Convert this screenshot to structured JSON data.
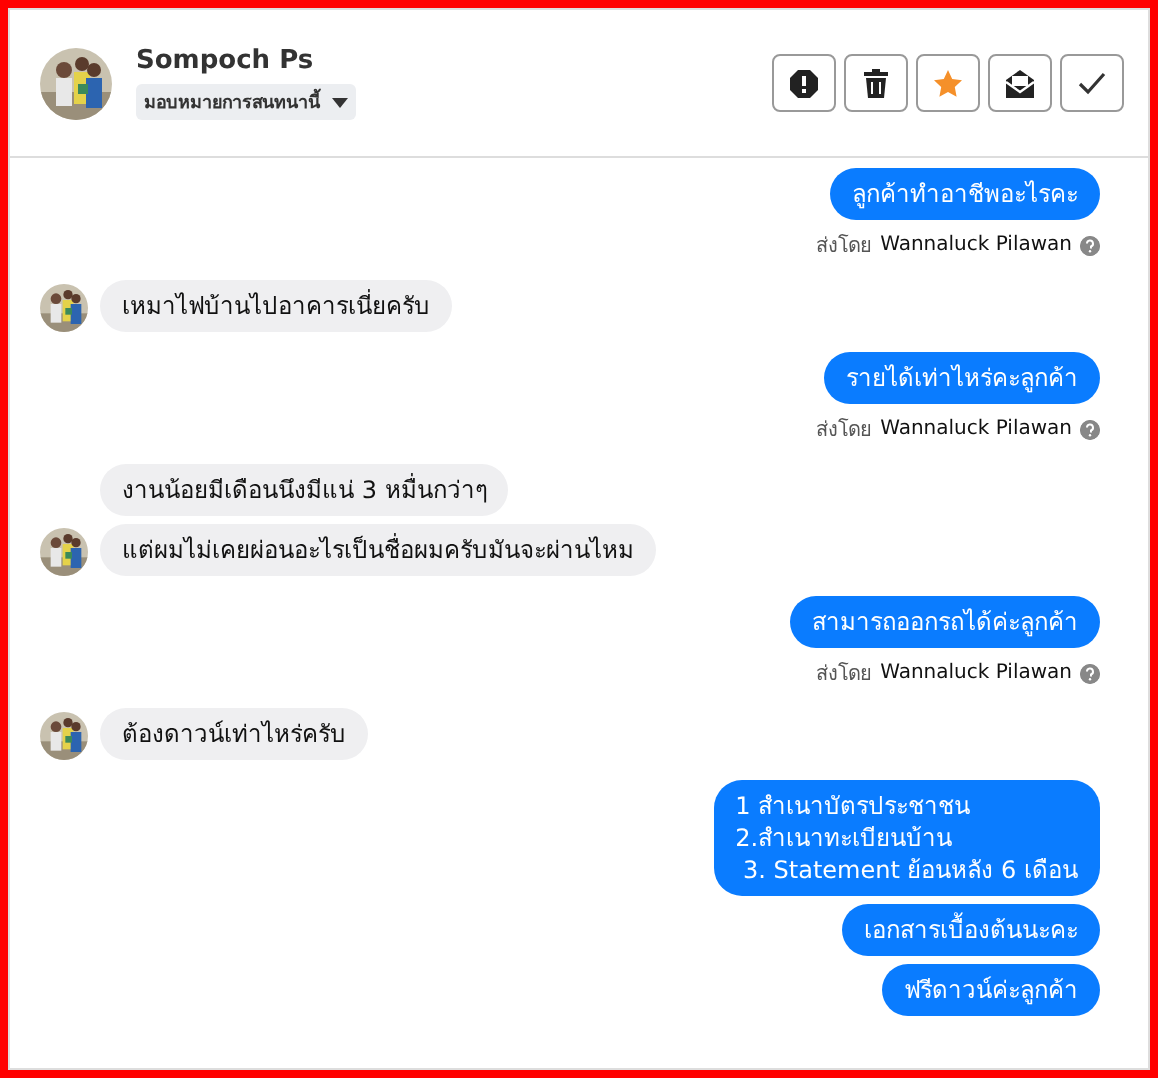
{
  "header": {
    "name": "Sompoch Ps",
    "assign_label": "มอบหมายการสนทนานี้",
    "actions": [
      {
        "kind": "report"
      },
      {
        "kind": "delete"
      },
      {
        "kind": "star",
        "on": true
      },
      {
        "kind": "mail"
      },
      {
        "kind": "done"
      }
    ]
  },
  "groups": [
    {
      "kind": "sent",
      "bubbles": [
        "ลูกค้าทำอาชีพอะไรคะ"
      ],
      "sent_prefix": "ส่งโดย",
      "sent_by": "Wannaluck Pilawan"
    },
    {
      "kind": "received",
      "bubbles": [
        "เหมาไฟบ้านไปอาคารเนี่ยครับ"
      ]
    },
    {
      "kind": "sent",
      "bubbles": [
        "รายได้เท่าไหร่คะลูกค้า"
      ],
      "sent_prefix": "ส่งโดย",
      "sent_by": "Wannaluck Pilawan"
    },
    {
      "kind": "received",
      "bubbles": [
        "งานน้อยมีเดือนนึงมีแน่ 3 หมื่นกว่าๆ",
        "แต่ผมไม่เคยผ่อนอะไรเป็นชื่อผมครับมันจะผ่านไหม"
      ]
    },
    {
      "kind": "sent",
      "bubbles": [
        "สามารถออกรถได้ค่ะลูกค้า"
      ],
      "sent_prefix": "ส่งโดย",
      "sent_by": "Wannaluck Pilawan"
    },
    {
      "kind": "received",
      "bubbles": [
        "ต้องดาวน์เท่าไหร่ครับ"
      ]
    },
    {
      "kind": "sent",
      "bubbles": [
        "1 สำเนาบัตรประชาชน\n2.สำเนาทะเบียนบ้าน\n 3. Statement ย้อนหลัง 6 เดือน",
        "เอกสารเบื้องต้นนะคะ",
        "ฟรีดาวน์ค่ะลูกค้า"
      ]
    }
  ]
}
